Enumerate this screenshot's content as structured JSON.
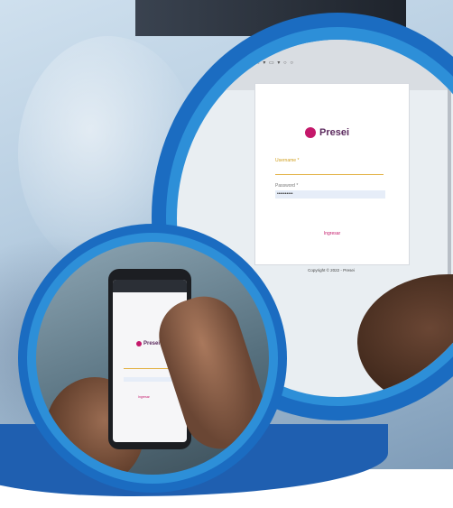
{
  "scene": {
    "description_free": true,
    "colors": {
      "ring_dark": "#1b6cc1",
      "ring_light": "#2d8fd8",
      "brand_magenta": "#c4186a",
      "brand_purple": "#5b2a5e",
      "field_accent": "#e2b040"
    }
  },
  "laptop": {
    "logo_text": "Presei",
    "field1_label": "Username *",
    "field1_hint": "",
    "field2_label": "Password *",
    "field2_value": "••••••••••",
    "login_button": "Ingresar",
    "footer_line1": "Copyright © 2022 - Presei",
    "footer_line2": ""
  },
  "phone": {
    "logo_text": "Presei",
    "login_button": "Ingresar"
  }
}
